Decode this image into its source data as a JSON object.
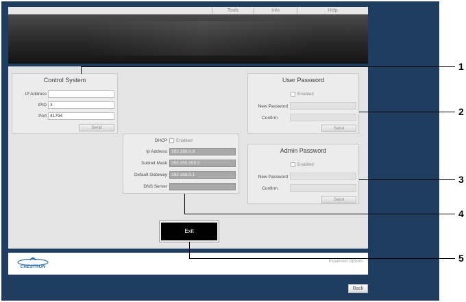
{
  "menu": {
    "items": [
      "Tools",
      "Info",
      "Help"
    ]
  },
  "control_system": {
    "title": "Control System",
    "ip_label": "IP Address",
    "ip_value": "",
    "ipid_label": "IPID",
    "ipid_value": "3",
    "port_label": "Port",
    "port_value": "41794",
    "send_label": "Send"
  },
  "network": {
    "dhcp_label": "DHCP",
    "dhcp_enabled_label": "Enabled",
    "dhcp_enabled": false,
    "ip_label": "Ip Address",
    "ip_value": "192.168.0.8",
    "subnet_label": "Subnet Mask",
    "subnet_value": "255.255.255.0",
    "gateway_label": "Default Gateway",
    "gateway_value": "192.168.0.1",
    "dns_label": "DNS Server",
    "dns_value": ""
  },
  "user_password": {
    "title": "User Password",
    "enabled_label": "Enabled",
    "enabled": false,
    "new_label": "New Password",
    "confirm_label": "Confirm",
    "send_label": "Send"
  },
  "admin_password": {
    "title": "Admin Password",
    "enabled_label": "Enabled",
    "enabled": false,
    "new_label": "New Password",
    "confirm_label": "Confirm",
    "send_label": "Send"
  },
  "exit_label": "Exit",
  "logo_text": "CRESTRON",
  "expansion_label": "Expansion Options",
  "back_label": "Back",
  "callouts": [
    "1",
    "2",
    "3",
    "4",
    "5"
  ],
  "colors": {
    "frame": "#1f3d60",
    "panel": "#e4e4e4",
    "exit_button": "#000000",
    "logo": "#2d6aa8"
  }
}
